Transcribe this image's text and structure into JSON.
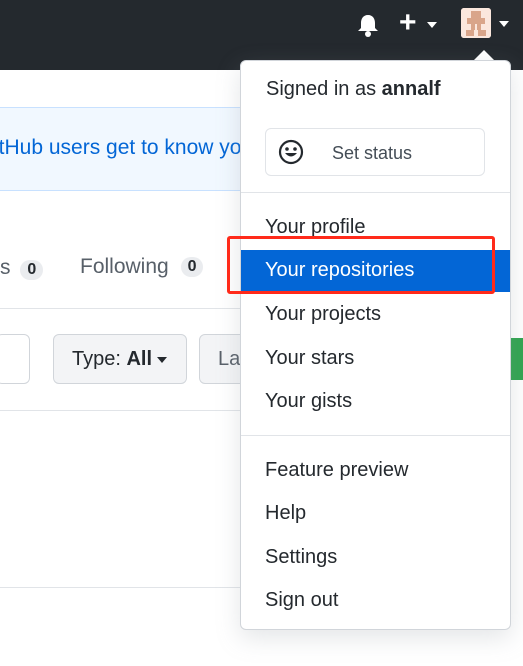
{
  "header": {
    "bell_icon": "bell-icon",
    "new_icon": "plus-icon",
    "avatar_icon": "avatar-icon"
  },
  "background": {
    "banner_text": "itHub users get to know yo",
    "tab_partial": "s",
    "tab_partial_count": "0",
    "following_label": "Following",
    "following_count": "0",
    "type_label": "Type:",
    "type_value": "All",
    "language_partial": "La"
  },
  "dropdown": {
    "signed_in_prefix": "Signed in as",
    "username": "annalf",
    "set_status_label": "Set status",
    "group1": [
      "Your profile",
      "Your repositories",
      "Your projects",
      "Your stars",
      "Your gists"
    ],
    "group2": [
      "Feature preview",
      "Help",
      "Settings",
      "Sign out"
    ],
    "active_item": "Your repositories"
  },
  "annotation": {
    "highlight_color": "#ff2a1a"
  },
  "colors": {
    "header_bg": "#24292e",
    "active_bg": "#0366d6",
    "link": "#0366d6"
  }
}
